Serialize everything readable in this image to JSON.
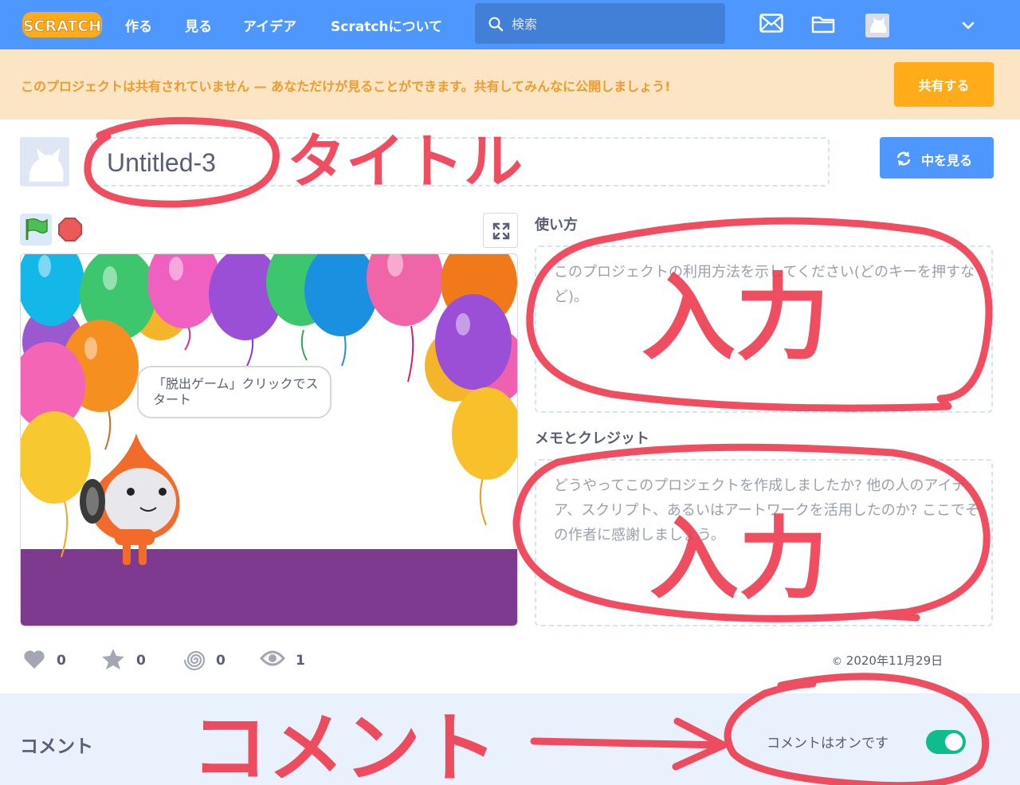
{
  "nav": {
    "logo": "SCRATCH",
    "links": [
      "作る",
      "見る",
      "アイデア",
      "Scratchについて"
    ],
    "search_placeholder": "検索",
    "icons": [
      "messages-icon",
      "my-stuff-folder-icon",
      "avatar",
      "chevron-down-icon"
    ]
  },
  "banner": {
    "message": "このプロジェクトは共有されていません — あなただけが見ることができます。共有してみんなに公開しましょう!",
    "share_label": "共有する"
  },
  "project": {
    "title": "Untitled-3",
    "see_inside_label": "中を見る"
  },
  "stage": {
    "speech_bubble": "「脱出ゲーム」クリックでスタート",
    "colors": {
      "floor": "#7e3a8f",
      "character": "#f26b2a"
    }
  },
  "instructions": {
    "label": "使い方",
    "placeholder": "このプロジェクトの利用方法を示してください(どのキーを押すなど)。"
  },
  "notes": {
    "label": "メモとクレジット",
    "placeholder": "どうやってこのプロジェクトを作成しましたか? 他の人のアイデア、スクリプト、あるいはアートワークを活用したのか? ここでその作者に感謝しましょう。"
  },
  "stats": {
    "loves": "0",
    "favorites": "0",
    "remixes": "0",
    "views": "1",
    "date": "2020年11月29日"
  },
  "comments": {
    "title": "コメント",
    "status": "コメントはオンです",
    "enabled": true
  },
  "annotations": {
    "title": "タイトル",
    "input_1": "入力",
    "input_2": "入力",
    "comment": "コメント",
    "color": "#ee3b4f"
  },
  "colors": {
    "nav": "#4d97ff",
    "banner_bg": "#fbe5c5",
    "banner_text": "#f29b2a",
    "share_button": "#ffab1a",
    "toggle_on": "#0fbd8c"
  }
}
